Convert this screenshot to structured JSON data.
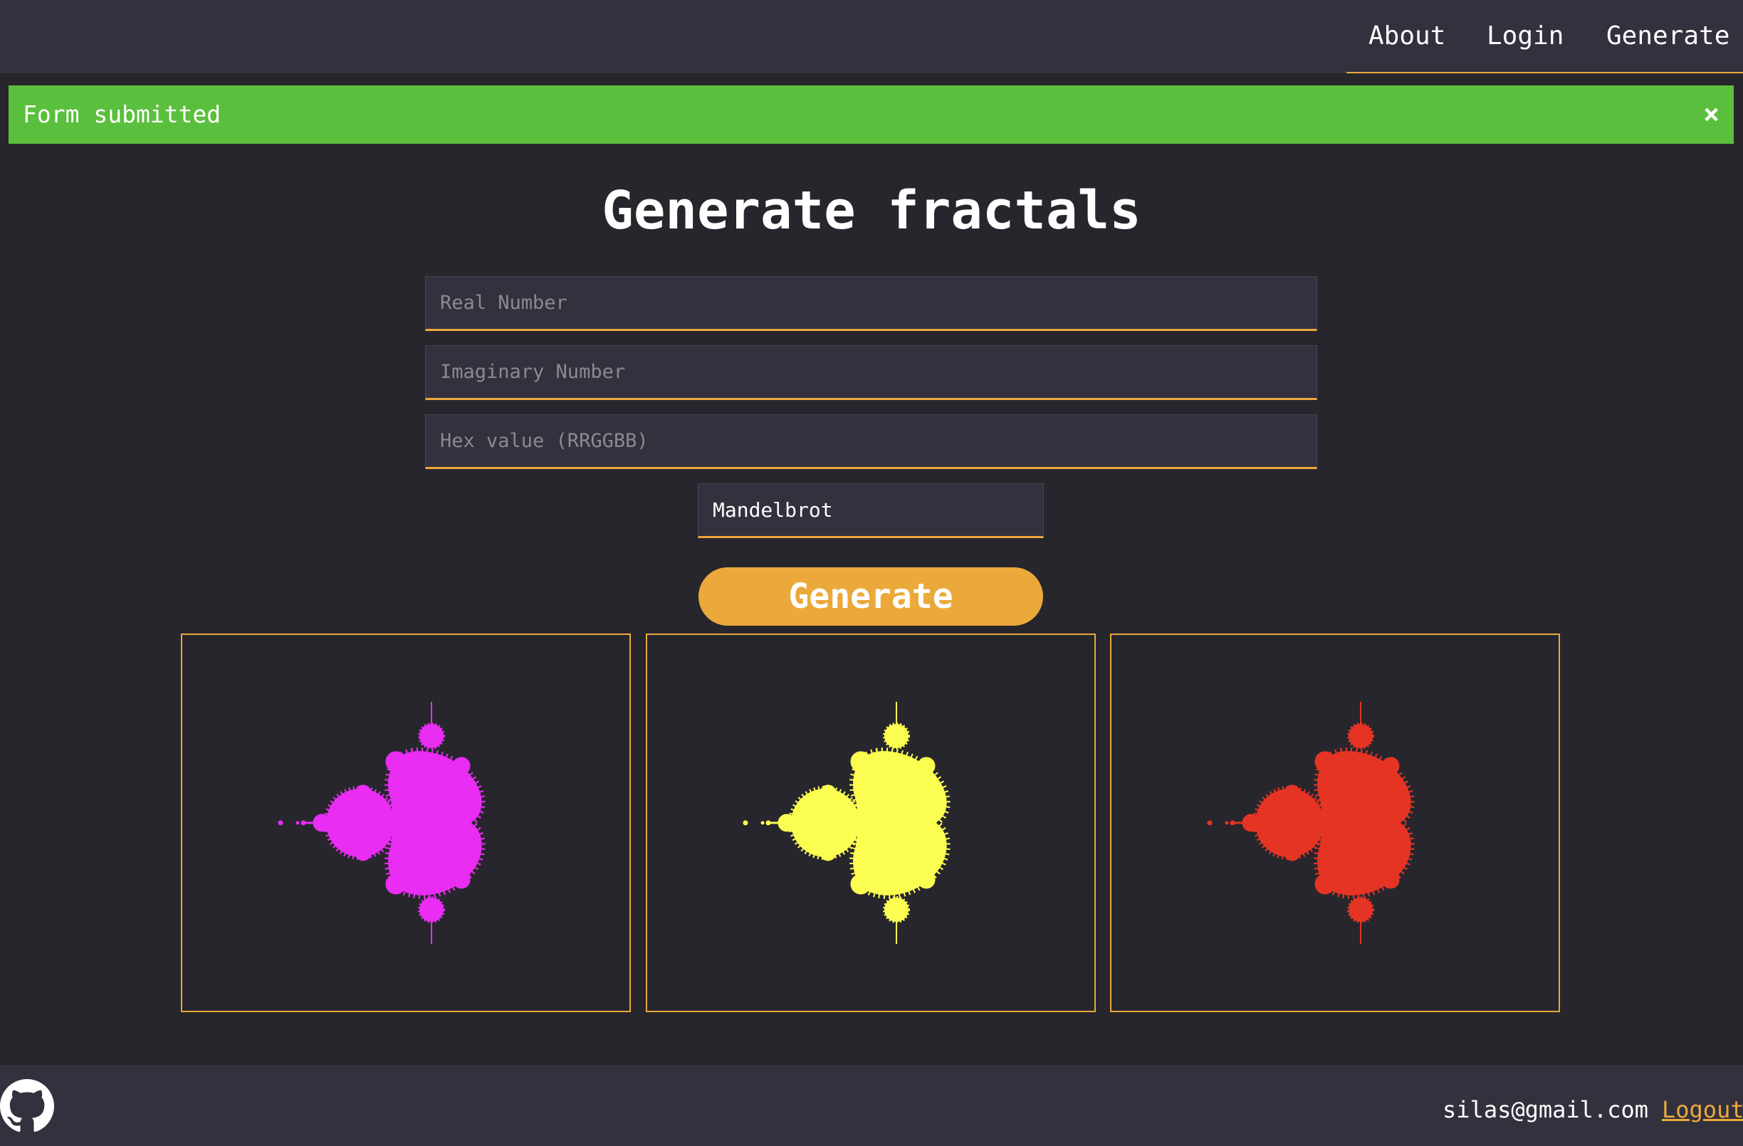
{
  "nav": {
    "links": [
      "About",
      "Login",
      "Generate"
    ],
    "accent_color": "#eba93b"
  },
  "flash": {
    "message": "Form submitted",
    "close_glyph": "×",
    "color": "#5bbf3e"
  },
  "page": {
    "title": "Generate fractals"
  },
  "form": {
    "real_placeholder": "Real Number",
    "real_value": "",
    "imaginary_placeholder": "Imaginary Number",
    "imaginary_value": "",
    "hex_placeholder": "Hex value (RRGGBB)",
    "hex_value": "",
    "fractal_type": "Mandelbrot",
    "submit_label": "Generate"
  },
  "results": [
    {
      "fractal": "Mandelbrot",
      "color": "#e92df2"
    },
    {
      "fractal": "Mandelbrot",
      "color": "#fbfe50"
    },
    {
      "fractal": "Mandelbrot",
      "color": "#e63424"
    }
  ],
  "footer": {
    "github_icon": "github-icon",
    "email": "silas@gmail.com",
    "logout_label": "Logout"
  }
}
